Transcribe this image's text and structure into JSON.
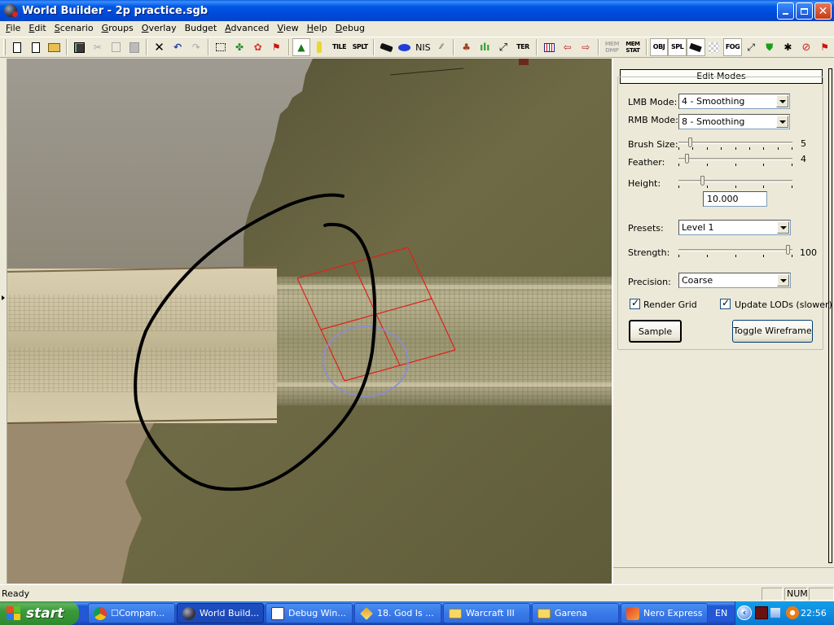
{
  "window": {
    "title": "World Builder - 2p practice.sgb"
  },
  "menu": [
    {
      "label": "File",
      "mnemonic": "F"
    },
    {
      "label": "Edit",
      "mnemonic": "E"
    },
    {
      "label": "Scenario",
      "mnemonic": "S"
    },
    {
      "label": "Groups",
      "mnemonic": "G"
    },
    {
      "label": "Overlay",
      "mnemonic": "O"
    },
    {
      "label": "Budget",
      "mnemonic": ""
    },
    {
      "label": "Advanced",
      "mnemonic": "A"
    },
    {
      "label": "View",
      "mnemonic": "V"
    },
    {
      "label": "Help",
      "mnemonic": "H"
    },
    {
      "label": "Debug",
      "mnemonic": "D"
    }
  ],
  "toolbar": {
    "text_buttons": {
      "tile": "TILE",
      "split": "SPLT",
      "nis": "NIS",
      "ter": "TER",
      "mem_dmp": "MEM DMP",
      "mem_stat": "MEM STAT",
      "obj": "OBJ",
      "spl": "SPL",
      "fog": "FOG"
    }
  },
  "panel": {
    "header": "Edit Modes",
    "lmb_mode": {
      "label": "LMB Mode:",
      "value": "4 - Smoothing"
    },
    "rmb_mode": {
      "label": "RMB Mode:",
      "value": "8 - Smoothing"
    },
    "brush_size": {
      "label": "Brush Size:",
      "value": "5",
      "fraction": 0.06
    },
    "feather": {
      "label": "Feather:",
      "value": "4",
      "fraction": 0.03
    },
    "height": {
      "label": "Height:",
      "value": "10.000",
      "fraction": 0.18
    },
    "presets": {
      "label": "Presets:",
      "value": "Level 1"
    },
    "strength": {
      "label": "Strength:",
      "value": "100",
      "fraction": 1.0
    },
    "precision": {
      "label": "Precision:",
      "value": "Coarse"
    },
    "render_grid": {
      "label": "Render Grid",
      "checked": true
    },
    "update_lods": {
      "label": "Update LODs (slower)",
      "checked": true
    },
    "sample_button": "Sample",
    "toggle_wireframe_button": "Toggle Wireframe"
  },
  "statusbar": {
    "text": "Ready",
    "num": "NUM"
  },
  "taskbar": {
    "start": "start",
    "tasks": [
      {
        "label": "☐Compan...",
        "icon": "chrome-icon",
        "active": false
      },
      {
        "label": "World Build...",
        "icon": "world-builder-icon",
        "active": true
      },
      {
        "label": "Debug Win...",
        "icon": "document-icon",
        "active": false
      },
      {
        "label": "18. God Is ...",
        "icon": "media-player-icon",
        "active": false
      },
      {
        "label": "Warcraft III",
        "icon": "folder-icon",
        "active": false
      },
      {
        "label": "Garena",
        "icon": "folder-icon",
        "active": false
      },
      {
        "label": "Nero Express",
        "icon": "nero-icon",
        "active": false
      }
    ],
    "language": "EN",
    "clock": "22:56"
  },
  "colors": {
    "grid_overlay": "#e0201c",
    "brush_circle": "#8a8cd8",
    "annotation_stroke": "#000000"
  }
}
